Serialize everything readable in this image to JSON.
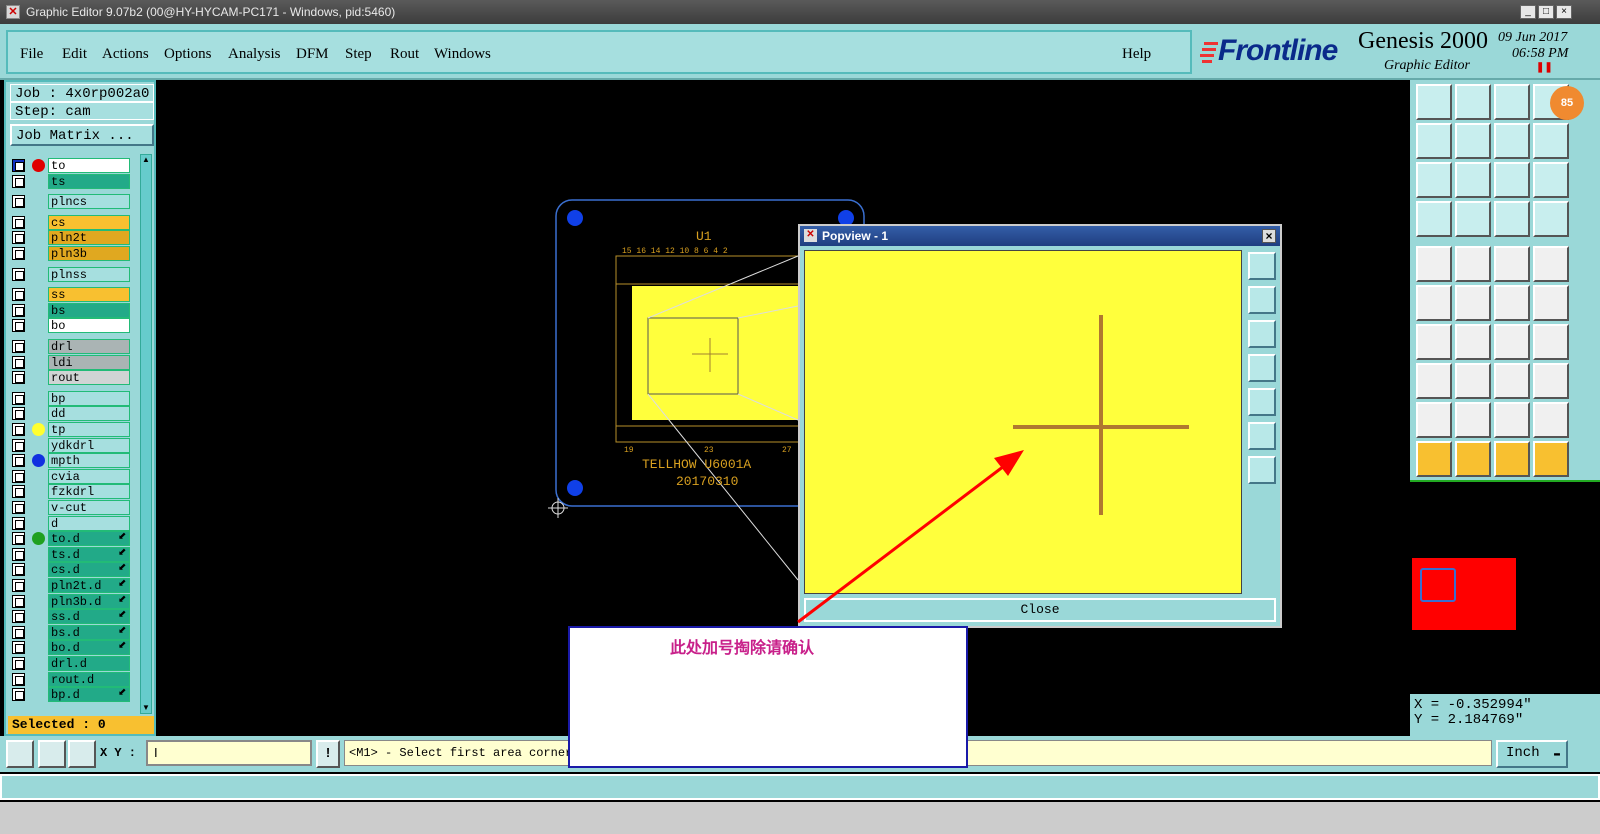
{
  "window": {
    "title": "Graphic Editor 9.07b2 (00@HY-HYCAM-PC171 - Windows, pid:5460)",
    "minimize": "_",
    "maximize": "□",
    "close": "×"
  },
  "menu": {
    "items": [
      "File",
      "Edit",
      "Actions",
      "Options",
      "Analysis",
      "DFM",
      "Step",
      "Rout",
      "Windows"
    ],
    "help": "Help"
  },
  "brand": {
    "logo": "Frontline",
    "product": "Genesis 2000",
    "subtitle": "Graphic Editor",
    "date": "09 Jun 2017",
    "time": "06:58 PM",
    "badge": "85"
  },
  "job": {
    "job_label": "Job : 4x0rp002a0",
    "step_label": "Step: cam",
    "matrix_button": "Job Matrix ...",
    "selected": "Selected : 0"
  },
  "layers": [
    {
      "name": "to",
      "color": "#ffffff",
      "dot": "#e00000",
      "mark": true
    },
    {
      "name": "ts",
      "color": "#22aa88",
      "dot": ""
    },
    {
      "name": "plncs",
      "color": "#a6dfdf",
      "dot": "",
      "gap": true
    },
    {
      "name": "cs",
      "color": "#f8c030",
      "dot": "",
      "gap": true
    },
    {
      "name": "pln2t",
      "color": "#e0a820",
      "dot": ""
    },
    {
      "name": "pln3b",
      "color": "#e0a820",
      "dot": ""
    },
    {
      "name": "plnss",
      "color": "#a6dfdf",
      "dot": "",
      "gap": true
    },
    {
      "name": "ss",
      "color": "#f8c030",
      "dot": "",
      "gap": true
    },
    {
      "name": "bs",
      "color": "#22aa88",
      "dot": ""
    },
    {
      "name": "bo",
      "color": "#ffffff",
      "dot": ""
    },
    {
      "name": "drl",
      "color": "#aab4b4",
      "dot": "",
      "gap": true
    },
    {
      "name": "ldi",
      "color": "#aab4b4",
      "dot": ""
    },
    {
      "name": "rout",
      "color": "#d0d4d4",
      "dot": ""
    },
    {
      "name": "bp",
      "color": "#a6dfdf",
      "dot": "",
      "gap": true
    },
    {
      "name": "dd",
      "color": "#a6dfdf",
      "dot": ""
    },
    {
      "name": "tp",
      "color": "#a6dfdf",
      "dot": "#ffff30"
    },
    {
      "name": "ydkdrl",
      "color": "#a6dfdf",
      "dot": ""
    },
    {
      "name": "mpth",
      "color": "#a6dfdf",
      "dot": "#1030e0"
    },
    {
      "name": "cvia",
      "color": "#a6dfdf",
      "dot": ""
    },
    {
      "name": "fzkdrl",
      "color": "#a6dfdf",
      "dot": ""
    },
    {
      "name": "v-cut",
      "color": "#a6dfdf",
      "dot": ""
    },
    {
      "name": "d",
      "color": "#a6dfdf",
      "dot": ""
    },
    {
      "name": "to.d",
      "color": "#22aa88",
      "dot": "#20a020",
      "tool": true
    },
    {
      "name": "ts.d",
      "color": "#22aa88",
      "dot": "",
      "tool": true
    },
    {
      "name": "cs.d",
      "color": "#22aa88",
      "dot": "",
      "tool": true
    },
    {
      "name": "pln2t.d",
      "color": "#22aa88",
      "dot": "",
      "tool": true
    },
    {
      "name": "pln3b.d",
      "color": "#22aa88",
      "dot": "",
      "tool": true
    },
    {
      "name": "ss.d",
      "color": "#22aa88",
      "dot": "",
      "tool": true
    },
    {
      "name": "bs.d",
      "color": "#22aa88",
      "dot": "",
      "tool": true
    },
    {
      "name": "bo.d",
      "color": "#22aa88",
      "dot": "",
      "tool": true
    },
    {
      "name": "drl.d",
      "color": "#22aa88",
      "dot": ""
    },
    {
      "name": "rout.d",
      "color": "#22aa88",
      "dot": ""
    },
    {
      "name": "bp.d",
      "color": "#22aa88",
      "dot": "",
      "tool": true
    }
  ],
  "board": {
    "refdes": "U1",
    "top_pins": "15 16 14 12 10 8  6  4  2",
    "bottom_pins_left": "19",
    "bottom_pins_mid": "23",
    "bottom_pins_right": "27",
    "text1": "TELLHOW U6001A",
    "text2": "20170310"
  },
  "popview": {
    "title": "Popview - 1",
    "close_button": "Close"
  },
  "note": {
    "text": "此处加号掏除请确认"
  },
  "coords": {
    "x": "X = -0.352994\"",
    "y": "Y = 2.184769\""
  },
  "bottom": {
    "xy_label": "X Y :",
    "xy_value": "I",
    "info_icon": "!",
    "prompt": "<M1> - Select first area corner",
    "unit": "Inch"
  },
  "colors": {
    "panel": "#9ad8d8",
    "popview_bg": "#ffff3c",
    "accent_red": "#ff0000",
    "board_outline": "#3a6fd0"
  }
}
